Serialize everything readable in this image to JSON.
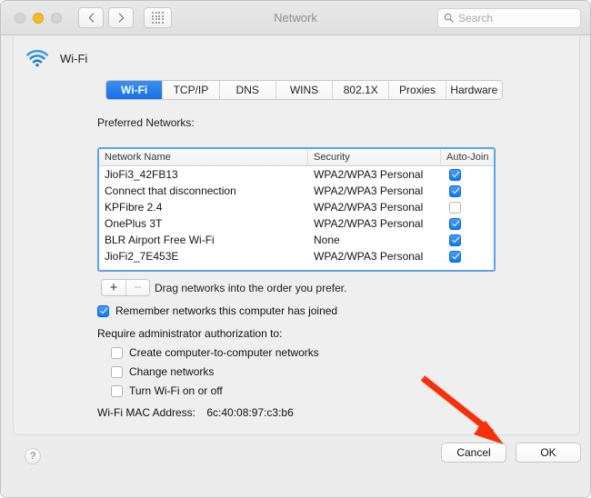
{
  "window": {
    "title": "Network",
    "traffic_lights": [
      {
        "name": "close",
        "color": "#d4d4d4"
      },
      {
        "name": "minimize",
        "color": "#f7b924"
      },
      {
        "name": "zoom",
        "color": "#d4d4d4"
      }
    ],
    "nav": {
      "back_icon": "chevron-left-icon",
      "forward_icon": "chevron-right-icon",
      "grid_icon": "show-all-grid-icon"
    },
    "search": {
      "placeholder": "Search",
      "value": "",
      "icon": "search-icon"
    }
  },
  "service": {
    "icon": "wifi-icon",
    "label": "Wi-Fi"
  },
  "tabs": [
    {
      "label": "Wi-Fi",
      "active": true
    },
    {
      "label": "TCP/IP",
      "active": false
    },
    {
      "label": "DNS",
      "active": false
    },
    {
      "label": "WINS",
      "active": false
    },
    {
      "label": "802.1X",
      "active": false
    },
    {
      "label": "Proxies",
      "active": false
    },
    {
      "label": "Hardware",
      "active": false
    }
  ],
  "preferred": {
    "label": "Preferred Networks:",
    "columns": [
      "Network Name",
      "Security",
      "Auto-Join"
    ],
    "rows": [
      {
        "name": "JioFi3_42FB13",
        "security": "WPA2/WPA3 Personal",
        "auto_join": true
      },
      {
        "name": "Connect that disconnection",
        "security": "WPA2/WPA3 Personal",
        "auto_join": true
      },
      {
        "name": "KPFibre 2.4",
        "security": "WPA2/WPA3 Personal",
        "auto_join": false
      },
      {
        "name": "OnePlus 3T",
        "security": "WPA2/WPA3 Personal",
        "auto_join": true
      },
      {
        "name": "BLR Airport Free Wi-Fi",
        "security": "None",
        "auto_join": true
      },
      {
        "name": "JioFi2_7E453E",
        "security": "WPA2/WPA3 Personal",
        "auto_join": true
      }
    ],
    "add_label": "+",
    "remove_label": "−",
    "drag_hint": "Drag networks into the order you prefer."
  },
  "options": {
    "remember": {
      "label": "Remember networks this computer has joined",
      "checked": true
    },
    "require_label": "Require administrator authorization to:",
    "require_items": [
      {
        "label": "Create computer-to-computer networks",
        "checked": false
      },
      {
        "label": "Change networks",
        "checked": false
      },
      {
        "label": "Turn Wi-Fi on or off",
        "checked": false
      }
    ]
  },
  "mac": {
    "label": "Wi-Fi MAC Address:",
    "value": "6c:40:08:97:c3:b6"
  },
  "footer": {
    "help_label": "?",
    "cancel_label": "Cancel",
    "ok_label": "OK"
  },
  "annotation": {
    "arrow_color": "#f72f0a",
    "points_at": "ok-button"
  }
}
